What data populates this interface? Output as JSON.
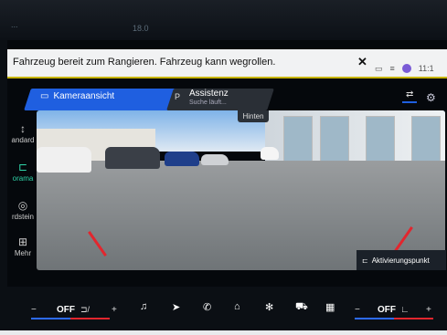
{
  "bezel": {
    "ghost_left": "...",
    "ghost_mid": "18.0"
  },
  "notification": {
    "text": "Fahrzeug bereit zum Rangieren. Fahrzeug kann wegrollen.",
    "close": "✕",
    "time": "11:1"
  },
  "tabs": {
    "camera": {
      "label": "Kameraansicht"
    },
    "assist": {
      "label": "Assistenz",
      "sub": "Suche läuft...",
      "icon": "P"
    }
  },
  "sidebar": {
    "items": [
      {
        "label": "andard",
        "icon": "↕"
      },
      {
        "label": "orama",
        "icon": "⊏"
      },
      {
        "label": "rdstein",
        "icon": "◎"
      },
      {
        "label": "Mehr",
        "icon": "⊞"
      }
    ]
  },
  "camera": {
    "hinten": "Hinten"
  },
  "activation": {
    "label": "Aktivierungspunkt"
  },
  "bottom": {
    "left_minus": "−",
    "left_off": "OFF",
    "left_plus": "+",
    "right_minus": "−",
    "right_off": "OFF",
    "right_plus": "+"
  },
  "colors": {
    "accent": "#1f5fe0",
    "active": "#2fd3a8",
    "warning": "#e2262e"
  }
}
